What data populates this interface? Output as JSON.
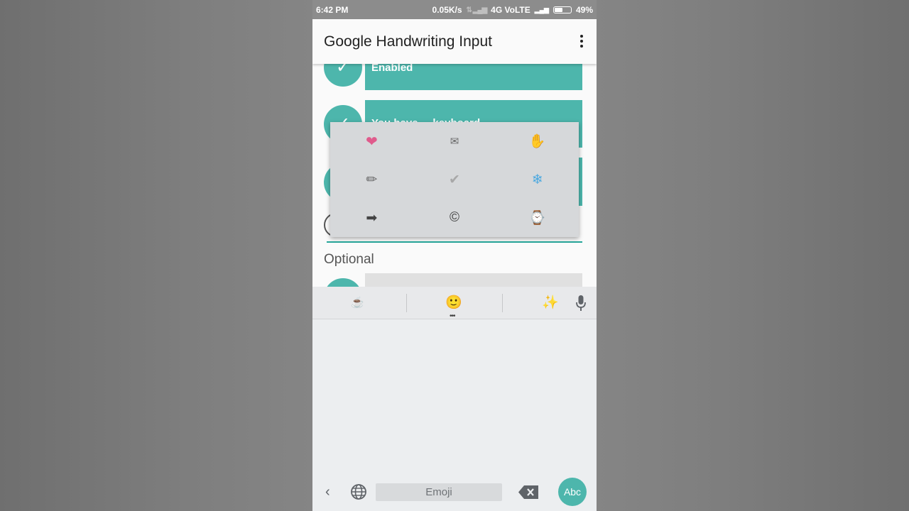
{
  "status_bar": {
    "time": "6:42 PM",
    "speed": "0.05K/s",
    "network": "4G VoLTE",
    "battery": "49%"
  },
  "app_bar": {
    "title": "Google Handwriting Input",
    "menu_icon": "overflow-menu-icon"
  },
  "steps": {
    "step1_label": "Enabled",
    "step2_label": "You have ... keyboard ..."
  },
  "section": {
    "optional_label": "Optional"
  },
  "emoji_popup": {
    "items": [
      "❤",
      "✉",
      "✋",
      "✏",
      "✔",
      "❄",
      "➡",
      "©",
      "⌚"
    ],
    "colors": [
      "#e05b8c",
      "#6b6b6b",
      "#f4b400",
      "#666666",
      "#a8a8a8",
      "#4aa8e0",
      "#444444",
      "#444444",
      "#555555"
    ]
  },
  "keyboard": {
    "tabs": [
      "☕",
      "🙂",
      "✨"
    ],
    "space_label": "Emoji",
    "mode_button": "Abc"
  },
  "colors": {
    "accent": "#4db6ac",
    "accent_dark": "#26a69a"
  }
}
